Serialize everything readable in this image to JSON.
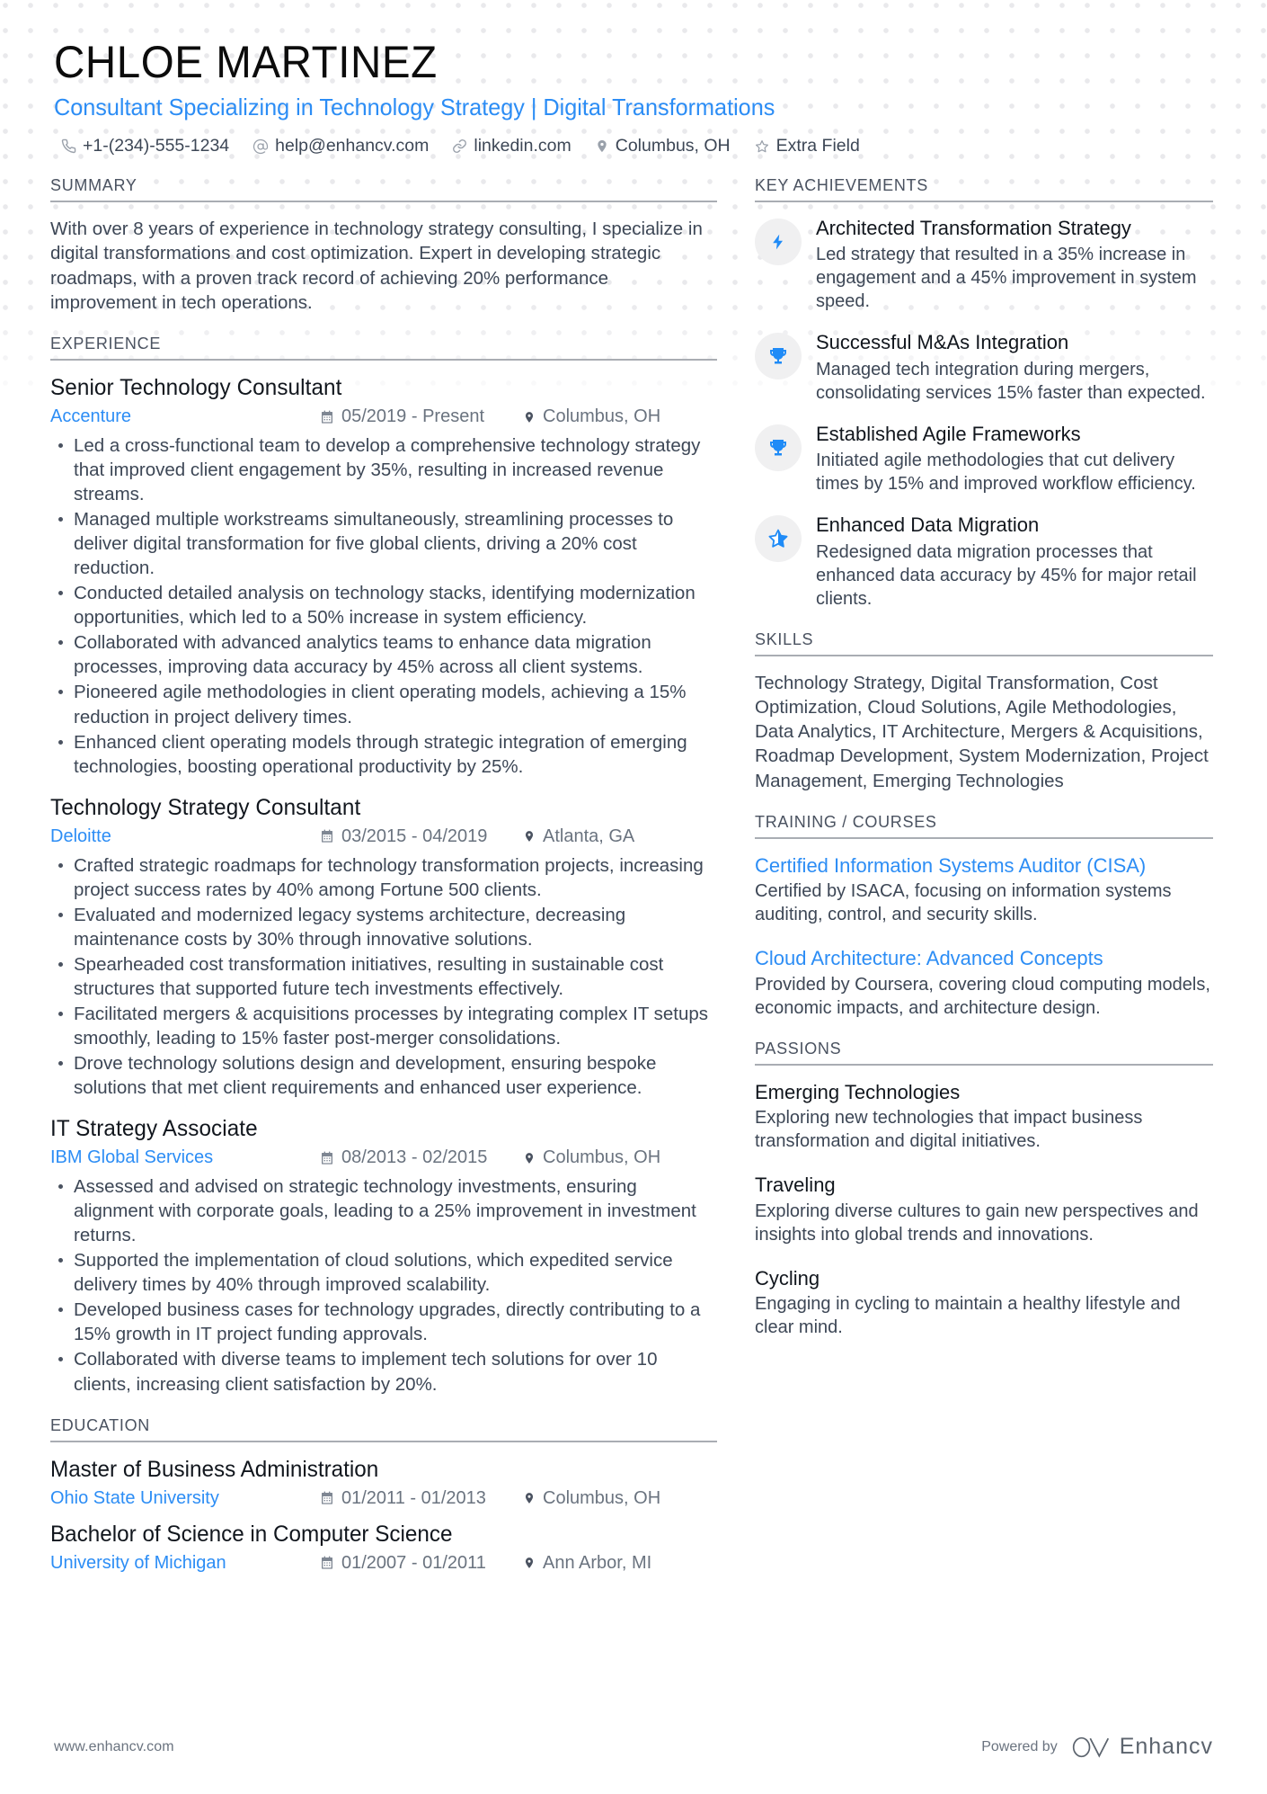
{
  "header": {
    "name": "CHLOE MARTINEZ",
    "headline": "Consultant Specializing in Technology Strategy | Digital Transformations",
    "contacts": [
      {
        "icon": "phone-icon",
        "text": "+1-(234)-555-1234"
      },
      {
        "icon": "email-icon",
        "text": "help@enhancv.com"
      },
      {
        "icon": "link-icon",
        "text": "linkedin.com"
      },
      {
        "icon": "location-pin-icon",
        "text": "Columbus, OH"
      },
      {
        "icon": "star-outline-icon",
        "text": "Extra Field"
      }
    ]
  },
  "summary": {
    "heading": "SUMMARY",
    "text": "With over 8 years of experience in technology strategy consulting, I specialize in digital transformations and cost optimization. Expert in developing strategic roadmaps, with a proven track record of achieving 20% performance improvement in tech operations."
  },
  "experience": {
    "heading": "EXPERIENCE",
    "jobs": [
      {
        "title": "Senior Technology Consultant",
        "company": "Accenture",
        "date": "05/2019 - Present",
        "location": "Columbus, OH",
        "bullets": [
          "Led a cross-functional team to develop a comprehensive technology strategy that improved client engagement by 35%, resulting in increased revenue streams.",
          "Managed multiple workstreams simultaneously, streamlining processes to deliver digital transformation for five global clients, driving a 20% cost reduction.",
          "Conducted detailed analysis on technology stacks, identifying modernization opportunities, which led to a 50% increase in system efficiency.",
          "Collaborated with advanced analytics teams to enhance data migration processes, improving data accuracy by 45% across all client systems.",
          "Pioneered agile methodologies in client operating models, achieving a 15% reduction in project delivery times.",
          "Enhanced client operating models through strategic integration of emerging technologies, boosting operational productivity by 25%."
        ]
      },
      {
        "title": "Technology Strategy Consultant",
        "company": "Deloitte",
        "date": "03/2015 - 04/2019",
        "location": "Atlanta, GA",
        "bullets": [
          "Crafted strategic roadmaps for technology transformation projects, increasing project success rates by 40% among Fortune 500 clients.",
          "Evaluated and modernized legacy systems architecture, decreasing maintenance costs by 30% through innovative solutions.",
          "Spearheaded cost transformation initiatives, resulting in sustainable cost structures that supported future tech investments effectively.",
          "Facilitated mergers & acquisitions processes by integrating complex IT setups smoothly, leading to 15% faster post-merger consolidations.",
          "Drove technology solutions design and development, ensuring bespoke solutions that met client requirements and enhanced user experience."
        ]
      },
      {
        "title": "IT Strategy Associate",
        "company": "IBM Global Services",
        "date": "08/2013 - 02/2015",
        "location": "Columbus, OH",
        "bullets": [
          "Assessed and advised on strategic technology investments, ensuring alignment with corporate goals, leading to a 25% improvement in investment returns.",
          "Supported the implementation of cloud solutions, which expedited service delivery times by 40% through improved scalability.",
          "Developed business cases for technology upgrades, directly contributing to a 15% growth in IT project funding approvals.",
          "Collaborated with diverse teams to implement tech solutions for over 10 clients, increasing client satisfaction by 20%."
        ]
      }
    ]
  },
  "education": {
    "heading": "EDUCATION",
    "entries": [
      {
        "title": "Master of Business Administration",
        "school": "Ohio State University",
        "date": "01/2011 - 01/2013",
        "location": "Columbus, OH"
      },
      {
        "title": "Bachelor of Science in Computer Science",
        "school": "University of Michigan",
        "date": "01/2007 - 01/2011",
        "location": "Ann Arbor, MI"
      }
    ]
  },
  "key_achievements": {
    "heading": "KEY ACHIEVEMENTS",
    "items": [
      {
        "icon": "lightning-bolt-icon",
        "title": "Architected Transformation Strategy",
        "desc": "Led strategy that resulted in a 35% increase in engagement and a 45% improvement in system speed."
      },
      {
        "icon": "trophy-icon",
        "title": "Successful M&As Integration",
        "desc": "Managed tech integration during mergers, consolidating services 15% faster than expected."
      },
      {
        "icon": "trophy-icon",
        "title": "Established Agile Frameworks",
        "desc": "Initiated agile methodologies that cut delivery times by 15% and improved workflow efficiency."
      },
      {
        "icon": "half-star-icon",
        "title": "Enhanced Data Migration",
        "desc": "Redesigned data migration processes that enhanced data accuracy by 45% for major retail clients."
      }
    ]
  },
  "skills": {
    "heading": "SKILLS",
    "text": "Technology Strategy, Digital Transformation, Cost Optimization, Cloud Solutions, Agile Methodologies, Data Analytics, IT Architecture, Mergers & Acquisitions, Roadmap Development, System Modernization, Project Management, Emerging Technologies"
  },
  "training": {
    "heading": "TRAINING / COURSES",
    "items": [
      {
        "title": "Certified Information Systems Auditor (CISA)",
        "desc": "Certified by ISACA, focusing on information systems auditing, control, and security skills."
      },
      {
        "title": "Cloud Architecture: Advanced Concepts",
        "desc": "Provided by Coursera, covering cloud computing models, economic impacts, and architecture design."
      }
    ]
  },
  "passions": {
    "heading": "PASSIONS",
    "items": [
      {
        "title": "Emerging Technologies",
        "desc": "Exploring new technologies that impact business transformation and digital initiatives."
      },
      {
        "title": "Traveling",
        "desc": "Exploring diverse cultures to gain new perspectives and insights into global trends and innovations."
      },
      {
        "title": "Cycling",
        "desc": "Engaging in cycling to maintain a healthy lifestyle and clear mind."
      }
    ]
  },
  "footer": {
    "url": "www.enhancv.com",
    "powered_by": "Powered by",
    "brand": "Enhancv"
  },
  "colors": {
    "accent": "#2c8df5",
    "text": "#3d4756",
    "heading": "#4a5260",
    "rule": "#a9adb3"
  }
}
